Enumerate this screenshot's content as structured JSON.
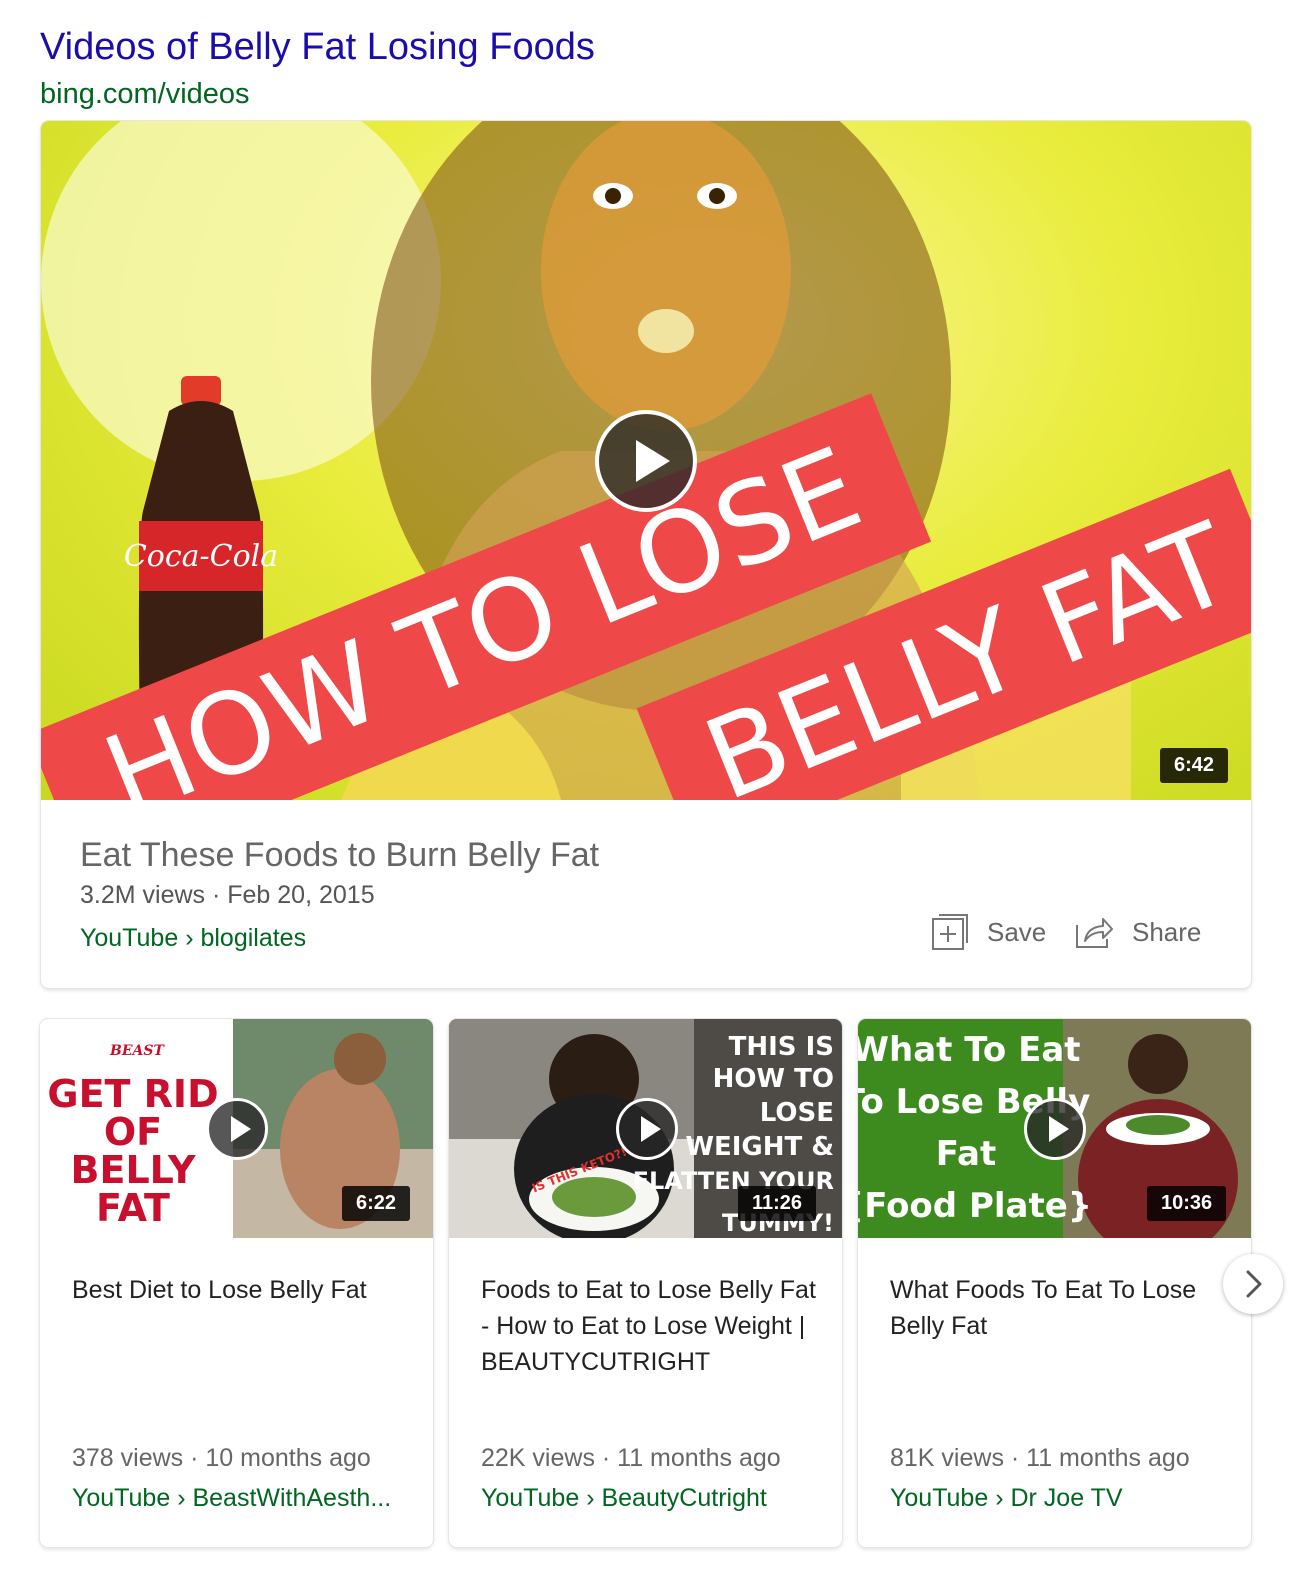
{
  "header": {
    "title": "Videos of Belly Fat Losing Foods",
    "url": "bing.com/videos"
  },
  "featured": {
    "thumbnail_text_line1": "HOW TO LOSE",
    "thumbnail_text_line2": "BELLY FAT",
    "bottle_label": "Coca-Cola",
    "duration": "6:42",
    "title": "Eat These Foods to Burn Belly Fat",
    "meta": "3.2M views · Feb 20, 2015",
    "source": "YouTube › blogilates",
    "save_label": "Save",
    "share_label": "Share"
  },
  "videos": [
    {
      "thumbnail_text": [
        "GET RID",
        "OF",
        "BELLY",
        "FAT"
      ],
      "logo_text": "BEAST",
      "duration": "6:22",
      "title": "Best Diet to Lose Belly Fat",
      "meta": "378 views · 10 months ago",
      "source": "YouTube › BeastWithAesth..."
    },
    {
      "thumbnail_text": [
        "THIS IS",
        "HOW TO",
        "LOSE",
        "WEIGHT &",
        "FLATTEN YOUR",
        "TUMMY!"
      ],
      "tag_text": "IS THIS KETO?!",
      "duration": "11:26",
      "title": "Foods to Eat to Lose Belly Fat - How to Eat to Lose Weight | BEAUTYCUTRIGHT",
      "meta": "22K views · 11 months ago",
      "source": "YouTube › BeautyCutright"
    },
    {
      "thumbnail_text": [
        "What To Eat",
        "To Lose Belly",
        "Fat",
        "{Food Plate}"
      ],
      "duration": "10:36",
      "title": "What Foods To Eat To Lose Belly Fat",
      "meta": "81K views · 11 months ago",
      "source": "YouTube › Dr Joe TV"
    }
  ],
  "colors": {
    "title_link": "#1a0dab",
    "source_green": "#006621",
    "banner_red": "#ef4848",
    "thumb_green": "#3d8a1e",
    "thumb_yellow": "#e9ec3c"
  }
}
